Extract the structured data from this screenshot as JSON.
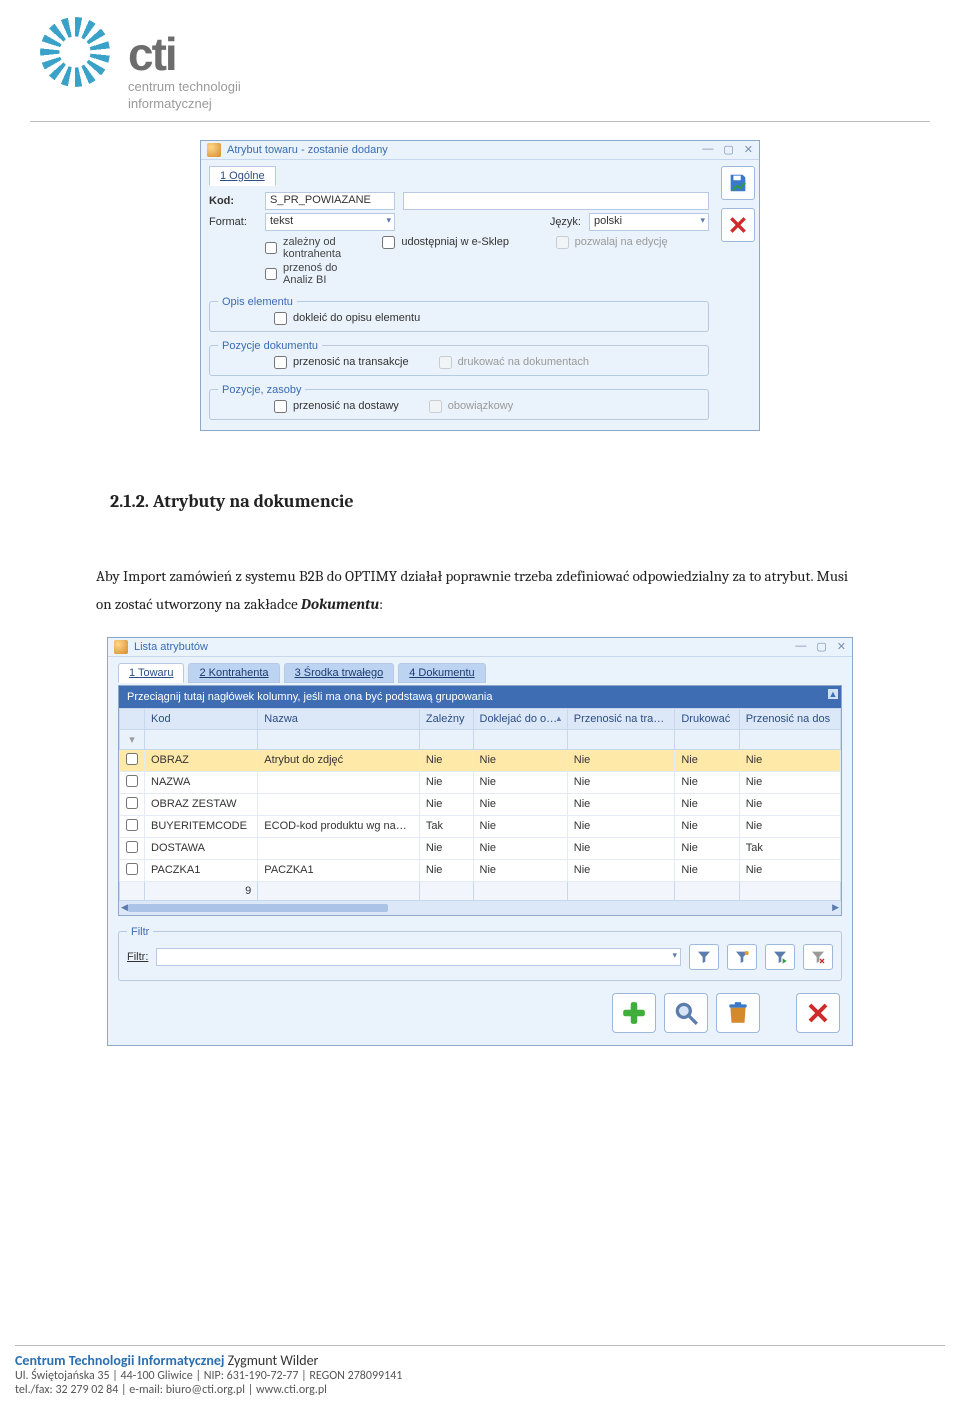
{
  "logo": {
    "word": "cti",
    "subtitle1": "centrum technologii",
    "subtitle2": "informatycznej"
  },
  "dlg1": {
    "title": "Atrybut towaru - zostanie dodany",
    "tab_ogolne": "1 Ogólne",
    "kod_label": "Kod:",
    "kod_value": "S_PR_POWIAZANE",
    "format_label": "Format:",
    "format_value": "tekst",
    "jezyk_label": "Język:",
    "jezyk_value": "polski",
    "chk_zalezny": "zależny od kontrahenta",
    "chk_udost": "udostępniaj w e-Sklep",
    "chk_pozwalaj": "pozwalaj na edycję",
    "chk_przenos_bi": "przenoś do Analiz BI",
    "grp_opis": "Opis elementu",
    "chk_dokleic": "dokleić do opisu elementu",
    "grp_pozdoc": "Pozycje dokumentu",
    "chk_przenosic_trans": "przenosić na transakcje",
    "chk_drukowac": "drukować na dokumentach",
    "grp_pozzas": "Pozycje, zasoby",
    "chk_przenosic_dost": "przenosić na dostawy",
    "chk_obow": "obowiązkowy"
  },
  "section": {
    "num": "2.1.2.",
    "title": "Atrybuty na dokumencie"
  },
  "para": {
    "t1": "Aby Import zamówień z systemu B2B do OPTIMY działał poprawnie trzeba zdefiniować odpowiedzialny za to atrybut. Musi on zostać utworzony na zakładce ",
    "em": "Dokumentu",
    "t2": ":"
  },
  "dlg2": {
    "title": "Lista atrybutów",
    "tabs": {
      "towaru": "1 Towaru",
      "kontr": "2 Kontrahenta",
      "srodka": "3 Środka trwałego",
      "dok": "4 Dokumentu"
    },
    "grouplabel": "Przeciągnij tutaj nagłówek kolumny, jeśli ma ona być podstawą grupowania",
    "cols": {
      "kod": "Kod",
      "nazwa": "Nazwa",
      "zalezny": "Zależny",
      "doklejac": "Doklejać do o…",
      "przenosic_tra": "Przenosić na tra…",
      "drukowac": "Drukować",
      "przenosic_dos": "Przenosić na dos"
    },
    "rows": [
      {
        "kod": "OBRAZ",
        "nazwa": "Atrybut do zdjęć",
        "zalezny": "Nie",
        "doklejac": "Nie",
        "przenosic_tra": "Nie",
        "drukowac": "Nie",
        "przenosic_dos": "Nie",
        "sel": true
      },
      {
        "kod": "NAZWA",
        "nazwa": "",
        "zalezny": "Nie",
        "doklejac": "Nie",
        "przenosic_tra": "Nie",
        "drukowac": "Nie",
        "przenosic_dos": "Nie"
      },
      {
        "kod": "OBRAZ ZESTAW",
        "nazwa": "",
        "zalezny": "Nie",
        "doklejac": "Nie",
        "przenosic_tra": "Nie",
        "drukowac": "Nie",
        "przenosic_dos": "Nie"
      },
      {
        "kod": "BUYERITEMCODE",
        "nazwa": "ECOD-kod produktu wg na…",
        "zalezny": "Tak",
        "doklejac": "Nie",
        "przenosic_tra": "Nie",
        "drukowac": "Nie",
        "przenosic_dos": "Nie"
      },
      {
        "kod": "DOSTAWA",
        "nazwa": "",
        "zalezny": "Nie",
        "doklejac": "Nie",
        "przenosic_tra": "Nie",
        "drukowac": "Nie",
        "przenosic_dos": "Tak"
      },
      {
        "kod": "PACZKA1",
        "nazwa": "PACZKA1",
        "zalezny": "Nie",
        "doklejac": "Nie",
        "przenosic_tra": "Nie",
        "drukowac": "Nie",
        "przenosic_dos": "Nie"
      }
    ],
    "footer_count": "9",
    "filtr_legend": "Filtr",
    "filtr_label": "Filtr:"
  },
  "footer": {
    "line1a": "Centrum Technologii Informatycznej",
    "line1b": " Zygmunt Wilder",
    "line2": "Ul. Świętojańska 35  |  44-100 Gliwice  |  NIP: 631-190-72-77  |  REGON 278099141",
    "line3": "tel./fax: 32 279 02 84  |  e-mail: biuro@cti.org.pl  |  www.cti.org.pl"
  }
}
